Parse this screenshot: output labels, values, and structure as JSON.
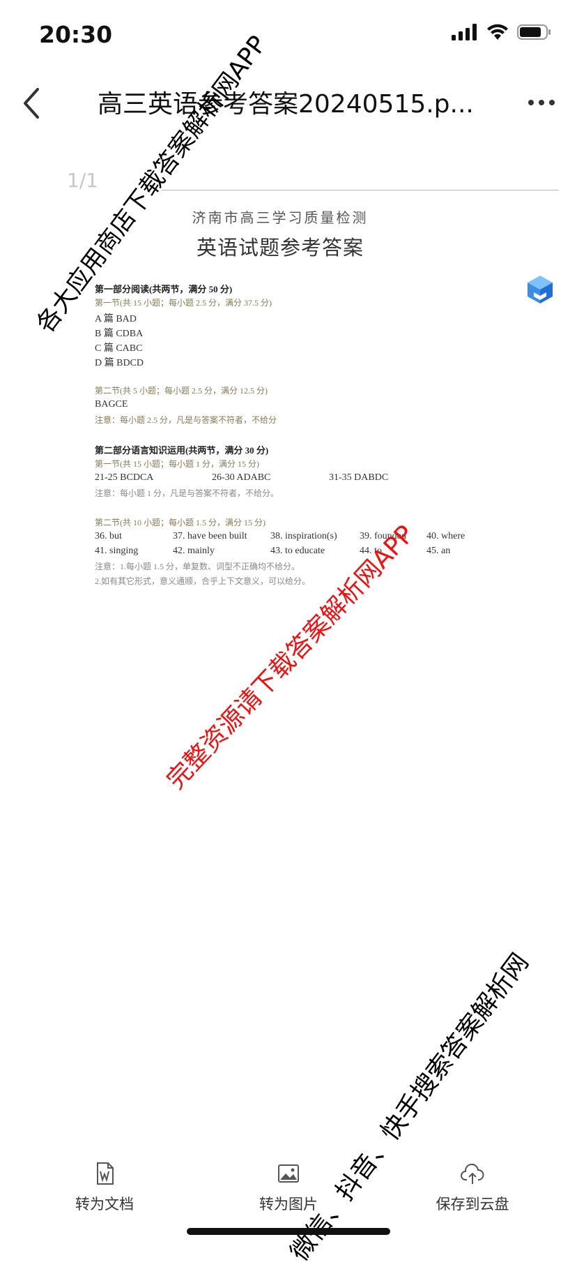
{
  "status_bar": {
    "time": "20:30"
  },
  "nav": {
    "title": "高三英语参考答案20240515.p..."
  },
  "viewer": {
    "page_indicator": "1/1"
  },
  "document": {
    "subtitle": "济南市高三学习质量检测",
    "title": "英语试题参考答案",
    "part1": {
      "heading": "第一部分阅读(共两节，满分 50 分)",
      "section1": "第一节(共 15 小题；每小题 2.5 分，满分 37.5 分)",
      "answers": [
        "A 篇 BAD",
        "B 篇 CDBA",
        "C 篇 CABC",
        "D 篇 BDCD"
      ],
      "section2": "第二节(共 5 小题；每小题 2.5 分，满分 12.5 分)",
      "section2_answer": "BAGCE",
      "section2_note": "注意：每小题 2.5 分，凡是与答案不符者，不给分"
    },
    "part2": {
      "heading": "第二部分语言知识运用(共两节，满分 30 分)",
      "section1": "第一节(共 15 小题；每小题 1 分，满分 15 分)",
      "answers": [
        "21-25 BCDCA",
        "26-30 ADABC",
        "31-35 DABDC"
      ],
      "section1_note": "注意：每小题 1 分，凡是与答案不符者，不给分。",
      "section2": "第二节(共 10 小题；每小题 1.5 分，满分 15 分)",
      "row1": [
        "36. but",
        "37. have been built",
        "38. inspiration(s)",
        "39. founded",
        "40. where"
      ],
      "row2": [
        "41. singing",
        "42. mainly",
        "43. to educate",
        "44. to",
        "45. an"
      ],
      "note1": "注意：1.每小题 1.5 分，单复数、词型不正确均不给分。",
      "note2": "2.如有其它形式，意义通顺，合乎上下文意义，可以给分。"
    }
  },
  "toolbar": {
    "items": [
      {
        "label": "转为文档",
        "icon": "word-doc-icon"
      },
      {
        "label": "转为图片",
        "icon": "image-icon"
      },
      {
        "label": "保存到云盘",
        "icon": "cloud-upload-icon"
      }
    ]
  },
  "watermarks": {
    "top_left": "各大应用商店下载答案解析网APP",
    "center": "完整资源请下载答案解析网APP",
    "bottom_right": "微信、抖音、快手搜索答案解析网"
  },
  "colors": {
    "watermark_red": "#f01010",
    "accent": "#3a8ee6"
  }
}
